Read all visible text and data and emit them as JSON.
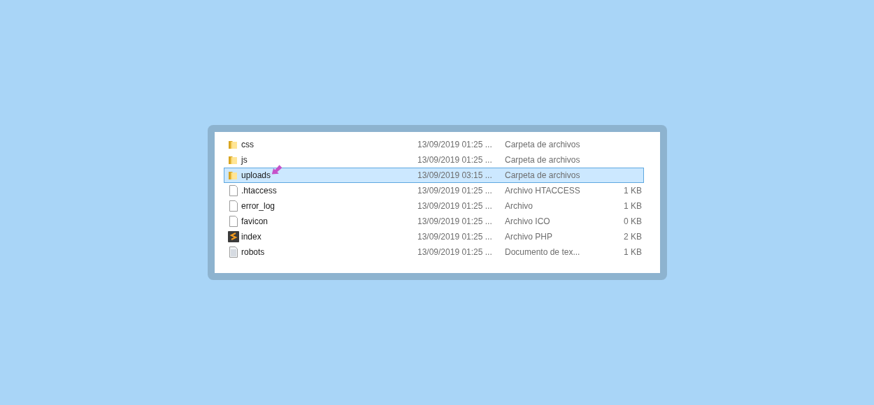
{
  "files": [
    {
      "kind": "folder",
      "name": "css",
      "modified": "13/09/2019 01:25 ...",
      "type": "Carpeta de archivos",
      "selected": false
    },
    {
      "kind": "folder",
      "name": "js",
      "modified": "13/09/2019 01:25 ...",
      "type": "Carpeta de archivos",
      "selected": false
    },
    {
      "kind": "folder",
      "name": "uploads",
      "modified": "13/09/2019 03:15 ...",
      "type": "Carpeta de archivos",
      "selected": true,
      "pointer": true
    },
    {
      "kind": "file",
      "name": ".htaccess",
      "modified": "13/09/2019 01:25 ...",
      "type": "Archivo HTACCESS",
      "size": "1 KB",
      "selected": false
    },
    {
      "kind": "file",
      "name": "error_log",
      "modified": "13/09/2019 01:25 ...",
      "type": "Archivo",
      "size": "1 KB",
      "selected": false
    },
    {
      "kind": "file",
      "name": "favicon",
      "modified": "13/09/2019 01:25 ...",
      "type": "Archivo ICO",
      "size": "0 KB",
      "selected": false
    },
    {
      "kind": "script",
      "name": "index",
      "modified": "13/09/2019 01:25 ...",
      "type": "Archivo PHP",
      "size": "2 KB",
      "selected": false
    },
    {
      "kind": "text",
      "name": "robots",
      "modified": "13/09/2019 01:25 ...",
      "type": "Documento de tex...",
      "size": "1 KB",
      "selected": false
    }
  ]
}
